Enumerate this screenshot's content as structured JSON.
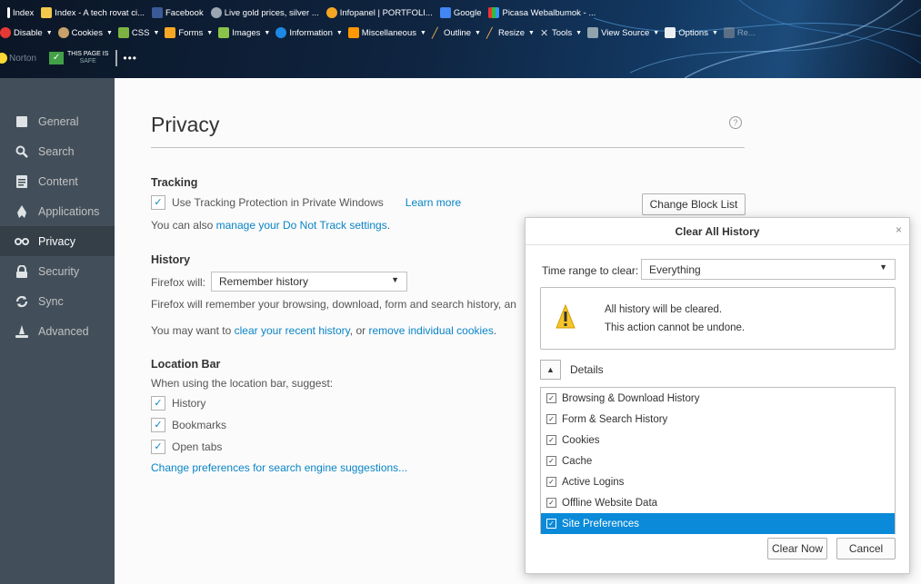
{
  "browser": {
    "bookmarks": [
      "Index",
      "Index - A tech rovat ci...",
      "Facebook",
      "Live gold prices, silver ...",
      "Infopanel | PORTFOLI...",
      "Google",
      "Picasa Webalbumok - ..."
    ],
    "devbar": [
      "Disable",
      "Cookies",
      "CSS",
      "Forms",
      "Images",
      "Information",
      "Miscellaneous",
      "Outline",
      "Resize",
      "Tools",
      "View Source",
      "Options",
      "Re..."
    ],
    "norton": {
      "brand": "Norton",
      "badge_line1": "THIS PAGE IS",
      "badge_line2": "SAFE",
      "more": "•••"
    }
  },
  "sidebar": {
    "items": [
      {
        "label": "General",
        "icon": "general-icon"
      },
      {
        "label": "Search",
        "icon": "search-icon"
      },
      {
        "label": "Content",
        "icon": "content-icon"
      },
      {
        "label": "Applications",
        "icon": "applications-icon"
      },
      {
        "label": "Privacy",
        "icon": "privacy-icon"
      },
      {
        "label": "Security",
        "icon": "security-icon"
      },
      {
        "label": "Sync",
        "icon": "sync-icon"
      },
      {
        "label": "Advanced",
        "icon": "advanced-icon"
      }
    ],
    "active": "Privacy"
  },
  "privacy": {
    "title": "Privacy",
    "help": "?",
    "tracking": {
      "heading": "Tracking",
      "checkbox_label": "Use Tracking Protection in Private Windows",
      "learn_more": "Learn more",
      "change_block_list": "Change Block List",
      "dnt_prefix": "You can also ",
      "dnt_link": "manage your Do Not Track settings",
      "dnt_suffix": "."
    },
    "history": {
      "heading": "History",
      "will_label": "Firefox will:",
      "will_value": "Remember history",
      "description": "Firefox will remember your browsing, download, form and search history, an",
      "clear_prefix": "You may want to ",
      "clear_link": "clear your recent history",
      "clear_mid": ", or ",
      "cookies_link": "remove individual cookies",
      "clear_suffix": "."
    },
    "location_bar": {
      "heading": "Location Bar",
      "suggest_label": "When using the location bar, suggest:",
      "options": [
        "History",
        "Bookmarks",
        "Open tabs"
      ],
      "change_link": "Change preferences for search engine suggestions..."
    }
  },
  "dialog": {
    "title": "Clear All History",
    "close": "×",
    "time_range_label": "Time range to clear:",
    "time_range_value": "Everything",
    "warning_line1": "All history will be cleared.",
    "warning_line2": "This action cannot be undone.",
    "details_label": "Details",
    "items": [
      {
        "label": "Browsing & Download History",
        "checked": true
      },
      {
        "label": "Form & Search History",
        "checked": true
      },
      {
        "label": "Cookies",
        "checked": true
      },
      {
        "label": "Cache",
        "checked": true
      },
      {
        "label": "Active Logins",
        "checked": true
      },
      {
        "label": "Offline Website Data",
        "checked": true
      },
      {
        "label": "Site Preferences",
        "checked": true
      }
    ],
    "selected_item": "Site Preferences",
    "clear_now": "Clear Now",
    "cancel": "Cancel"
  }
}
